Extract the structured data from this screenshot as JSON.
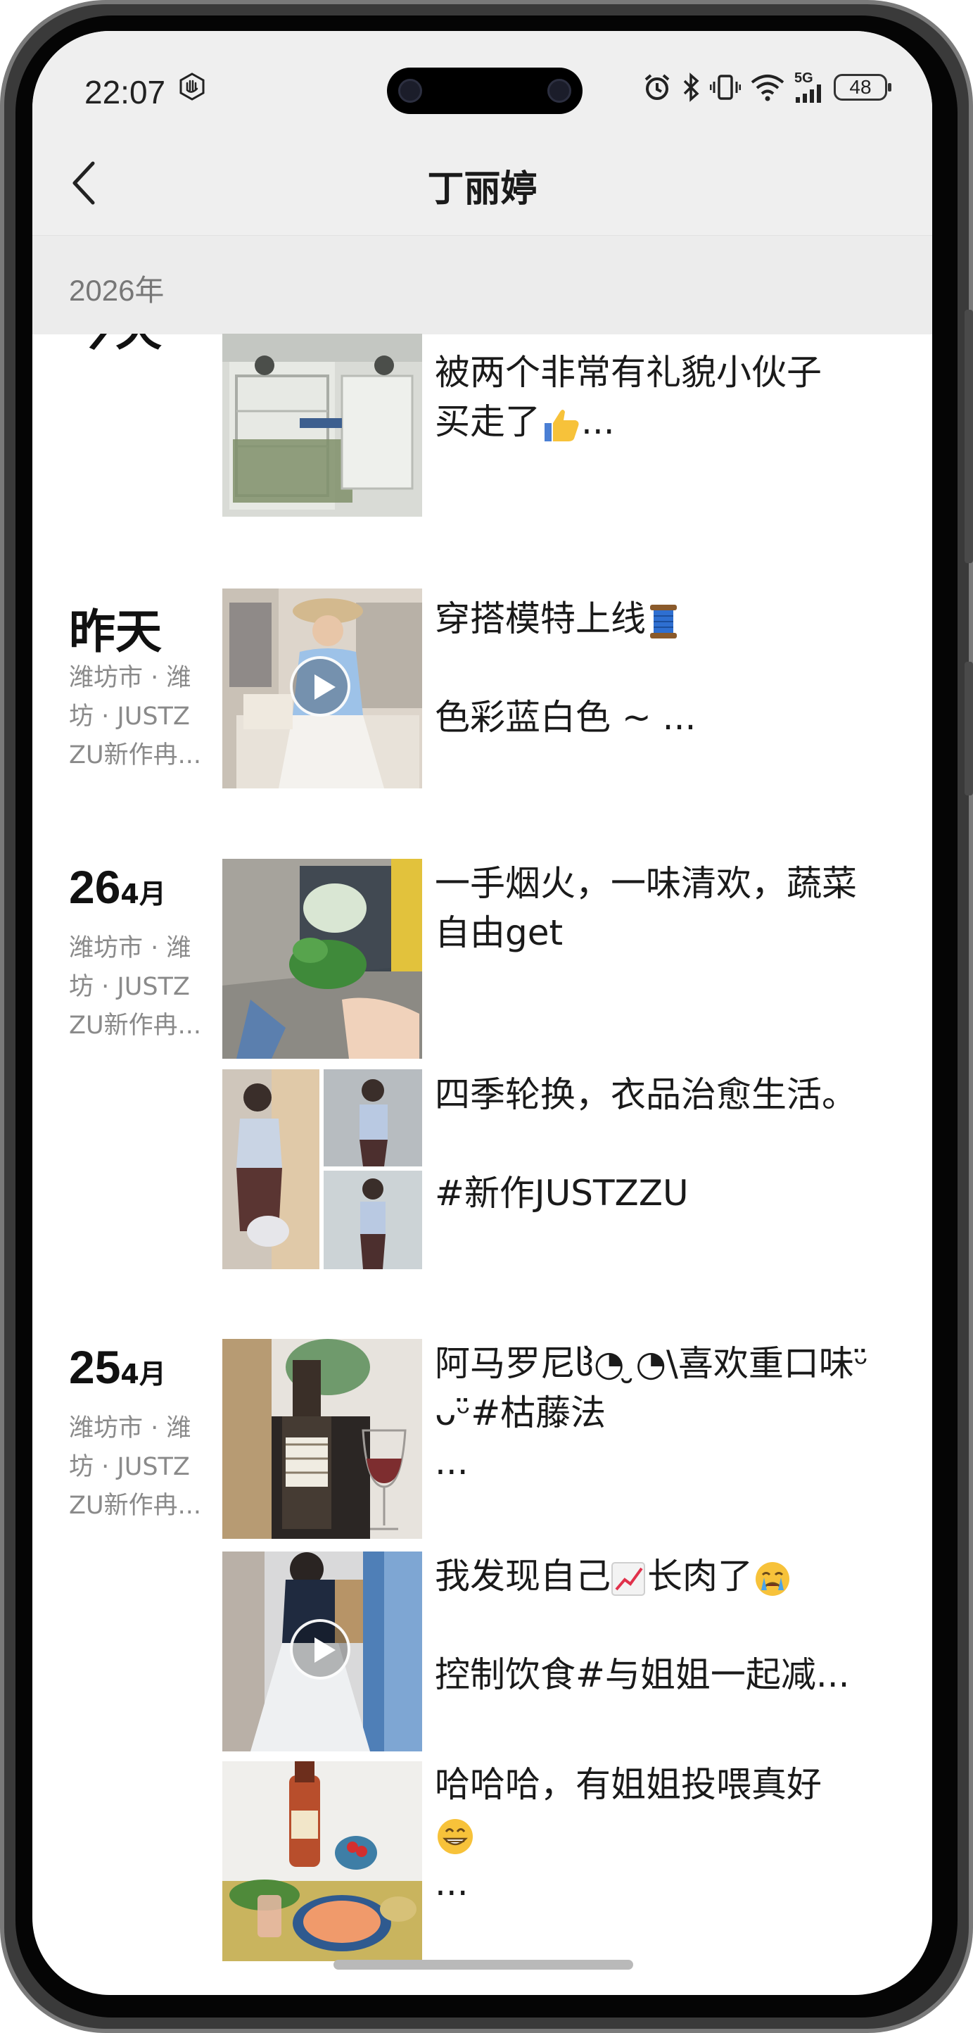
{
  "status_bar": {
    "time": "22:07",
    "network": "5G",
    "battery": "48"
  },
  "header": {
    "title": "丁丽婷"
  },
  "year_header": "2026年",
  "partial_date": "今天",
  "posts": [
    {
      "text_lines": [
        "被两个非常有礼貌小伙子",
        "买走了"
      ],
      "emoji": "thumbs-up",
      "more": "..."
    },
    {
      "date": "昨天",
      "location_lines": [
        "潍坊市 · 潍",
        "坊 · JUSTZ",
        "ZU新作冉..."
      ],
      "text_lines": [
        "穿搭模特上线",
        "",
        "色彩蓝白色 ~ ..."
      ],
      "emoji": "spool",
      "is_video": true
    },
    {
      "date_num": "26",
      "date_month": "4月",
      "location_lines": [
        "潍坊市 · 潍",
        "坊 · JUSTZ",
        "ZU新作冉..."
      ],
      "items": [
        {
          "text_lines": [
            "一手烟火，一味清欢，蔬菜",
            "自由get"
          ]
        },
        {
          "text_lines": [
            "四季轮换，衣品治愈生活。",
            "",
            "#新作JUSTZZU"
          ]
        }
      ]
    },
    {
      "date_num": "25",
      "date_month": "4月",
      "location_lines": [
        "潍坊市 · 潍",
        "坊 · JUSTZ",
        "ZU新作冉..."
      ],
      "items": [
        {
          "text_lines": [
            "阿马罗尼ჱ̒◔ ̮◔\\喜欢重口味ᵕ̈",
            "ᴗᵕ̈#枯藤法",
            "..."
          ]
        },
        {
          "text_lines": [
            "我发现自己",
            "长肉了",
            "控制饮食#与姐姐一起减..."
          ],
          "is_video": true
        },
        {
          "text_lines": [
            "哈哈哈，有姐姐投喂真好",
            "..."
          ]
        }
      ]
    }
  ]
}
